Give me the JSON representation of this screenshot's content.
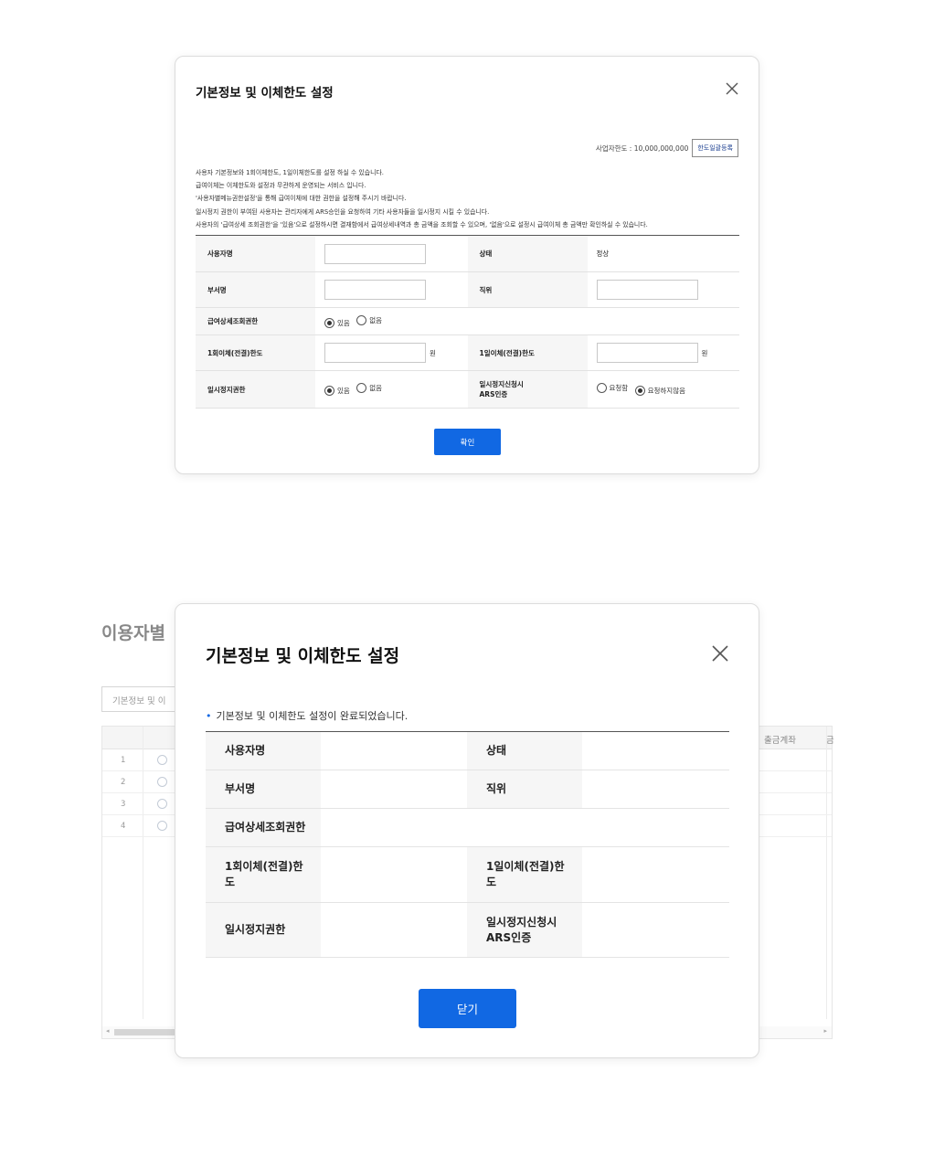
{
  "modal1": {
    "title": "기본정보 및 이체한도 설정",
    "limit_text": "사업자한도 : 10,000,000,000",
    "limit_button": "한도일괄등록",
    "notes": [
      "사용자 기본정보와 1회이체한도, 1일이체한도를 설정 하실 수 있습니다.",
      "급여이체는 이체한도와 설정과 무관하게 운영되는 서비스 입니다.",
      "'사용자별메뉴권한설정'을 통해 급여이체에 대한 권한을 설정해 주시기 바랍니다.",
      "일시정지 권한이 부여된 사용자는 관리자에게 ARS승인을 요청하여 기타 사용자들을 일시정지 시킬 수 있습니다.",
      "사용자의 '급여상세 조회권한'을 '있음'으로 설정하시면 결재함에서 급여상세내역과 총 금액을 조회할 수 있으며, '없음'으로 설정시 급여이체 총 금액만 확인하실 수 있습니다."
    ],
    "labels": {
      "user_name": "사용자명",
      "status": "상태",
      "dept": "부서명",
      "position": "직위",
      "payroll_view": "급여상세조회권한",
      "once_limit": "1회이체(전결)한도",
      "daily_limit": "1일이체(전결)한도",
      "suspend": "일시정지권한",
      "suspend_ars_1": "일시정지신청시",
      "suspend_ars_2": "ARS인증"
    },
    "status_value": "정상",
    "unit": "원",
    "options": {
      "yes": "있음",
      "no": "없음",
      "request": "요청함",
      "no_request": "요청하지않음"
    },
    "confirm_button": "확인"
  },
  "background": {
    "page_title": "이용자별",
    "tab_label": "기본정보 및 이",
    "col_withdraw": "출금계좌",
    "col_next": "금",
    "rows": [
      "1",
      "2",
      "3",
      "4"
    ],
    "scroll_left": "◂",
    "scroll_right": "▸"
  },
  "modal2": {
    "title": "기본정보 및 이체한도 설정",
    "message": "기본정보 및 이체한도 설정이 완료되었습니다.",
    "bullet": "•",
    "labels": {
      "user_name": "사용자명",
      "status": "상태",
      "dept": "부서명",
      "position": "직위",
      "payroll_view": "급여상세조회권한",
      "once_limit": "1회이체(전결)한도",
      "daily_limit": "1일이체(전결)한도",
      "suspend": "일시정지권한",
      "suspend_ars_1": "일시정지신청시",
      "suspend_ars_2": "ARS인증"
    },
    "close_button": "닫기"
  },
  "icons": {
    "close": "close-icon",
    "radio": "radio-icon"
  },
  "colors": {
    "primary": "#1168e3",
    "link": "#1a3d8f",
    "header_bg": "#f6f6f6"
  }
}
